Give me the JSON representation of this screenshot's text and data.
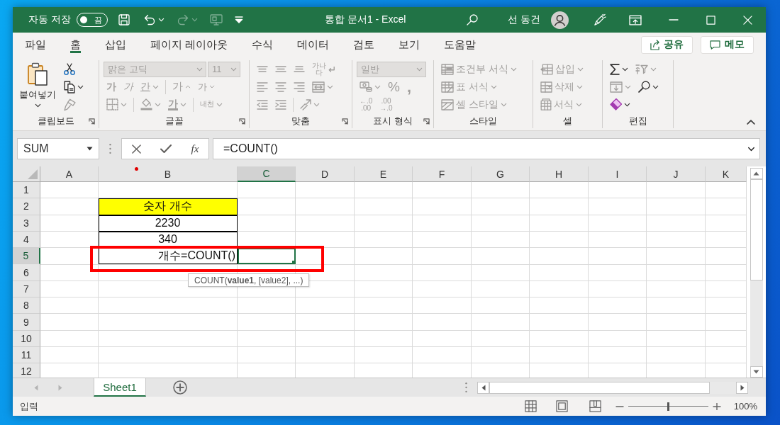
{
  "title_bar": {
    "autosave_label": "자동 저장",
    "autosave": {
      "label": "끔",
      "on": false
    },
    "quick_access": [
      {
        "kind": "save",
        "disabled": false
      },
      {
        "kind": "undo",
        "disabled": false,
        "caret": true
      },
      {
        "kind": "redo",
        "disabled": true,
        "caret": true
      },
      {
        "kind": "touch",
        "disabled": true
      },
      {
        "kind": "customize",
        "disabled": false
      }
    ],
    "document_title": "통합 문서1 - Excel",
    "user_name": "선 동건"
  },
  "menu": {
    "tabs": [
      {
        "label": "파일",
        "selected": false
      },
      {
        "label": "홈",
        "selected": true
      },
      {
        "label": "삽입",
        "selected": false
      },
      {
        "label": "페이지 레이아웃",
        "selected": false
      },
      {
        "label": "수식",
        "selected": false
      },
      {
        "label": "데이터",
        "selected": false
      },
      {
        "label": "검토",
        "selected": false
      },
      {
        "label": "보기",
        "selected": false
      },
      {
        "label": "도움말",
        "selected": false
      }
    ],
    "share_button": "공유",
    "comment_button": "메모"
  },
  "ribbon": {
    "groups": [
      {
        "label": "클립보드",
        "launcher": true,
        "large": {
          "label": "붙여넣기",
          "disabled": false
        },
        "lines": [
          {
            "controls": [
              {
                "kind": "cut",
                "disabled": false
              }
            ]
          },
          {
            "controls": [
              {
                "kind": "copy",
                "disabled": false,
                "caret": true
              }
            ]
          },
          {
            "controls": [
              {
                "kind": "format-painter",
                "disabled": true
              }
            ]
          }
        ]
      },
      {
        "label": "글꼴",
        "launcher": true,
        "lines": [
          {
            "controls": [
              {
                "kind": "font-box",
                "label": "맑은 고딕",
                "disabled": true
              },
              {
                "kind": "size-box",
                "label": "11",
                "disabled": true
              }
            ]
          },
          {
            "controls": [
              {
                "kind": "bold",
                "label": "가",
                "disabled": true
              },
              {
                "kind": "italic",
                "label": "가",
                "disabled": true
              },
              {
                "kind": "underline",
                "label": "간",
                "disabled": true,
                "caret": true
              },
              {
                "kind": "separator"
              },
              {
                "kind": "grow",
                "label": "가",
                "disabled": true
              },
              {
                "kind": "shrink",
                "label": "가",
                "disabled": true
              }
            ]
          },
          {
            "controls": [
              {
                "kind": "borders",
                "disabled": true,
                "caret": true
              },
              {
                "kind": "separator"
              },
              {
                "kind": "fill-color",
                "disabled": true,
                "caret": true
              },
              {
                "kind": "font-color",
                "label": "가",
                "disabled": true,
                "caret": true
              },
              {
                "kind": "separator"
              },
              {
                "kind": "phonetic",
                "label": "내천",
                "disabled": true,
                "caret": true
              }
            ]
          }
        ]
      },
      {
        "label": "맞춤",
        "launcher": true,
        "lines": [
          {
            "controls": [
              {
                "kind": "align-top",
                "disabled": true
              },
              {
                "kind": "align-middle",
                "disabled": true
              },
              {
                "kind": "align-bottom",
                "disabled": true
              },
              {
                "kind": "wrap",
                "label": "가나다",
                "disabled": true
              }
            ]
          },
          {
            "controls": [
              {
                "kind": "align-left",
                "disabled": true
              },
              {
                "kind": "align-center",
                "disabled": true
              },
              {
                "kind": "align-right",
                "disabled": true
              },
              {
                "kind": "merge",
                "disabled": true,
                "caret": true
              }
            ]
          },
          {
            "controls": [
              {
                "kind": "decrease-indent",
                "disabled": true
              },
              {
                "kind": "increase-indent",
                "disabled": true
              },
              {
                "kind": "separator"
              },
              {
                "kind": "orientation",
                "disabled": true,
                "caret": true
              }
            ]
          }
        ]
      },
      {
        "label": "표시 형식",
        "launcher": true,
        "lines": [
          {
            "controls": [
              {
                "kind": "format-box",
                "label": "일반",
                "disabled": true
              }
            ]
          },
          {
            "controls": [
              {
                "kind": "accounting",
                "disabled": true,
                "caret": true
              },
              {
                "kind": "percent",
                "label": "%",
                "disabled": true
              },
              {
                "kind": "comma",
                "label": ",",
                "disabled": true
              }
            ]
          },
          {
            "controls": [
              {
                "kind": "increase-decimal",
                "lines": [
                  "←.0",
                  ".00"
                ],
                "disabled": true
              },
              {
                "kind": "decrease-decimal",
                "lines": [
                  ".00",
                  "→.0"
                ],
                "disabled": true
              }
            ]
          }
        ]
      },
      {
        "label": "스타일",
        "launcher": false,
        "lines": [
          {
            "controls": [
              {
                "kind": "conditional-format",
                "label": "조건부 서식",
                "disabled": true,
                "caret": true
              }
            ]
          },
          {
            "controls": [
              {
                "kind": "table-format",
                "label": "표 서식",
                "disabled": true,
                "caret": true
              }
            ]
          },
          {
            "controls": [
              {
                "kind": "cell-styles",
                "label": "셀 스타일",
                "disabled": true,
                "caret": true
              }
            ]
          }
        ]
      },
      {
        "label": "셀",
        "launcher": false,
        "lines": [
          {
            "controls": [
              {
                "kind": "insert",
                "label": "삽입",
                "disabled": true,
                "caret": true
              }
            ]
          },
          {
            "controls": [
              {
                "kind": "delete",
                "label": "삭제",
                "disabled": true,
                "caret": true
              }
            ]
          },
          {
            "controls": [
              {
                "kind": "format",
                "label": "서식",
                "disabled": true,
                "caret": true
              }
            ]
          }
        ]
      },
      {
        "label": "편집",
        "launcher": false,
        "lines": [
          {
            "controls": [
              {
                "kind": "autosum",
                "disabled": false,
                "caret": true
              },
              {
                "kind": "sort-filter",
                "disabled": true,
                "caret": true
              }
            ]
          },
          {
            "controls": [
              {
                "kind": "fill",
                "disabled": true,
                "caret": true
              },
              {
                "kind": "find",
                "disabled": false,
                "caret": true
              }
            ]
          },
          {
            "controls": [
              {
                "kind": "clear",
                "disabled": false,
                "caret": true
              }
            ]
          }
        ]
      }
    ]
  },
  "formula_bar": {
    "name_box": "SUM",
    "function_label": "fx",
    "formula": "=COUNT()"
  },
  "sheet": {
    "columns": [
      {
        "label": "A",
        "selected": false
      },
      {
        "label": "B",
        "selected": false
      },
      {
        "label": "C",
        "selected": true
      },
      {
        "label": "D",
        "selected": false
      },
      {
        "label": "E",
        "selected": false
      },
      {
        "label": "F",
        "selected": false
      },
      {
        "label": "G",
        "selected": false
      },
      {
        "label": "H",
        "selected": false
      },
      {
        "label": "I",
        "selected": false
      },
      {
        "label": "J",
        "selected": false
      },
      {
        "label": "K",
        "selected": false
      }
    ],
    "rows": [
      {
        "label": "1",
        "selected": false
      },
      {
        "label": "2",
        "selected": false
      },
      {
        "label": "3",
        "selected": false
      },
      {
        "label": "4",
        "selected": false
      },
      {
        "label": "5",
        "selected": true
      },
      {
        "label": "6",
        "selected": false
      },
      {
        "label": "7",
        "selected": false
      },
      {
        "label": "8",
        "selected": false
      },
      {
        "label": "9",
        "selected": false
      },
      {
        "label": "10",
        "selected": false
      },
      {
        "label": "11",
        "selected": false
      },
      {
        "label": "12",
        "selected": false
      }
    ],
    "table": [
      {
        "kind": "header",
        "text": "숫자 개수"
      },
      {
        "kind": "value",
        "text": "2230"
      },
      {
        "kind": "value",
        "text": "340"
      },
      {
        "kind": "formula",
        "text": "개수=COUNT()"
      }
    ],
    "tooltip": "COUNT(**value1**, [value2], ...)"
  },
  "annotations": {
    "frame": true,
    "dot": true
  },
  "sheet_navigation": [
    {
      "kind": "previous",
      "disabled": true
    },
    {
      "kind": "next",
      "disabled": true
    }
  ],
  "sheet_tabs": [
    {
      "label": "Sheet1",
      "selected": true
    }
  ],
  "status_bar": {
    "mode": "입력",
    "zoom": {
      "level": 0.5,
      "reading": "100%"
    }
  }
}
